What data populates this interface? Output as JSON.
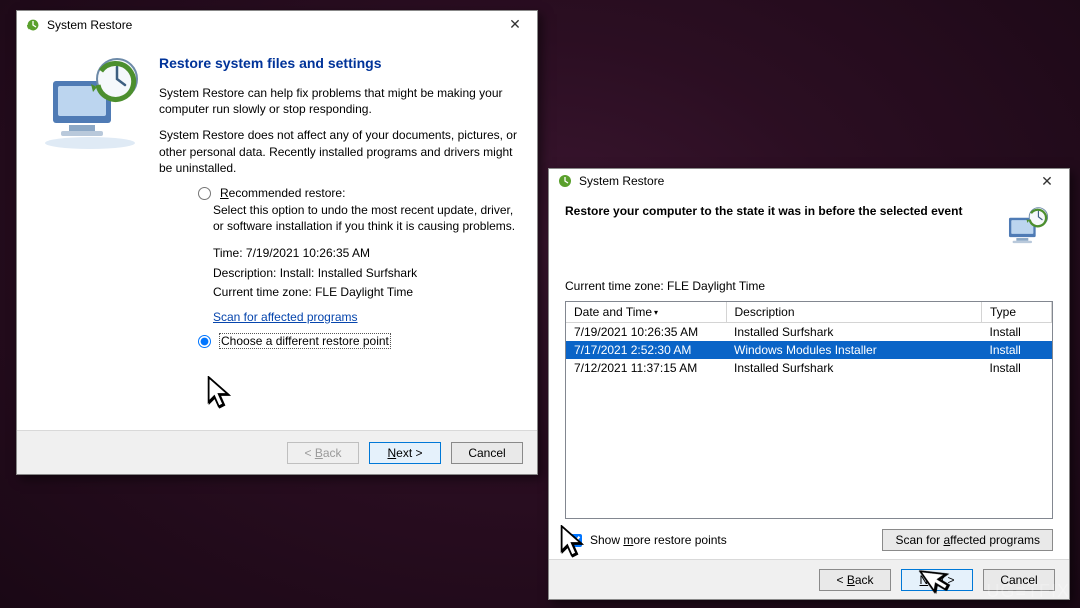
{
  "window1": {
    "title": "System Restore",
    "heading": "Restore system files and settings",
    "para1": "System Restore can help fix problems that might be making your computer run slowly or stop responding.",
    "para2": "System Restore does not affect any of your documents, pictures, or other personal data. Recently installed programs and drivers might be uninstalled.",
    "recommended_label": "Recommended restore:",
    "recommended_desc": "Select this option to undo the most recent update, driver, or software installation if you think it is causing problems.",
    "info_time_label": "Time:",
    "info_time_value": "7/19/2021 10:26:35 AM",
    "info_desc_label": "Description:",
    "info_desc_value": "Install: Installed Surfshark",
    "info_tz_label": "Current time zone:",
    "info_tz_value": "FLE Daylight Time",
    "scan_link": "Scan for affected programs",
    "choose_label": "Choose a different restore point",
    "btn_back": "< Back",
    "btn_next": "Next >",
    "btn_cancel": "Cancel"
  },
  "window2": {
    "title": "System Restore",
    "heading": "Restore your computer to the state it was in before the selected event",
    "tz_line": "Current time zone: FLE Daylight Time",
    "columns": {
      "c1": "Date and Time",
      "c2": "Description",
      "c3": "Type"
    },
    "rows": [
      {
        "dt": "7/19/2021 10:26:35 AM",
        "desc": "Installed Surfshark",
        "type": "Install",
        "selected": false
      },
      {
        "dt": "7/17/2021 2:52:30 AM",
        "desc": "Windows Modules Installer",
        "type": "Install",
        "selected": true
      },
      {
        "dt": "7/12/2021 11:37:15 AM",
        "desc": "Installed Surfshark",
        "type": "Install",
        "selected": false
      }
    ],
    "show_more": "Show more restore points",
    "scan_btn": "Scan for affected programs",
    "btn_back": "< Back",
    "btn_next": "Next >",
    "btn_cancel": "Cancel"
  },
  "watermark": "UG≡TFIX"
}
